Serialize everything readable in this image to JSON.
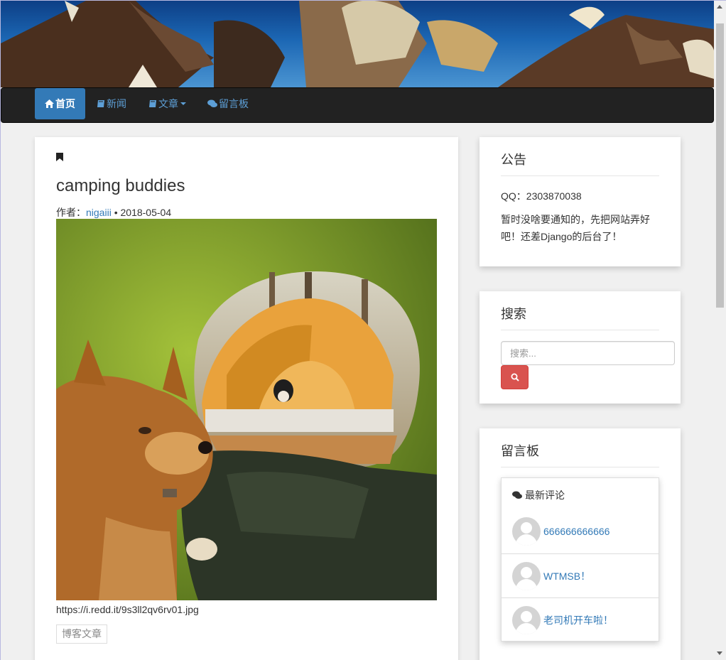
{
  "nav": {
    "home": "首页",
    "news": "新闻",
    "articles": "文章",
    "guestbook": "留言板"
  },
  "post": {
    "title": "camping buddies",
    "author_label": "作者：",
    "author": "nigaiii",
    "separator": " • ",
    "date": "2018-05-04",
    "image_url_text": "https://i.redd.it/9s3ll2qv6rv01.jpg",
    "tag": "博客文章"
  },
  "notice": {
    "title": "公告",
    "qq": "QQ：2303870038",
    "text": "暂时没啥要通知的，先把网站弄好吧！还差Django的后台了！"
  },
  "search": {
    "title": "搜索",
    "placeholder": "搜索..."
  },
  "guestbook": {
    "title": "留言板",
    "header": "最新评论",
    "comments": [
      {
        "text": "666666666666"
      },
      {
        "text": "WTMSB！"
      },
      {
        "text": "老司机开车啦！"
      }
    ]
  },
  "colors": {
    "nav_active": "#337ab7",
    "link": "#337ab7",
    "search_button": "#d9534f",
    "navbar_bg": "#222222"
  },
  "icons": {
    "home": "home-icon",
    "news": "book-icon",
    "articles": "book-icon",
    "guestbook": "comments-icon",
    "bookmark": "bookmark-icon",
    "search": "search-icon"
  }
}
